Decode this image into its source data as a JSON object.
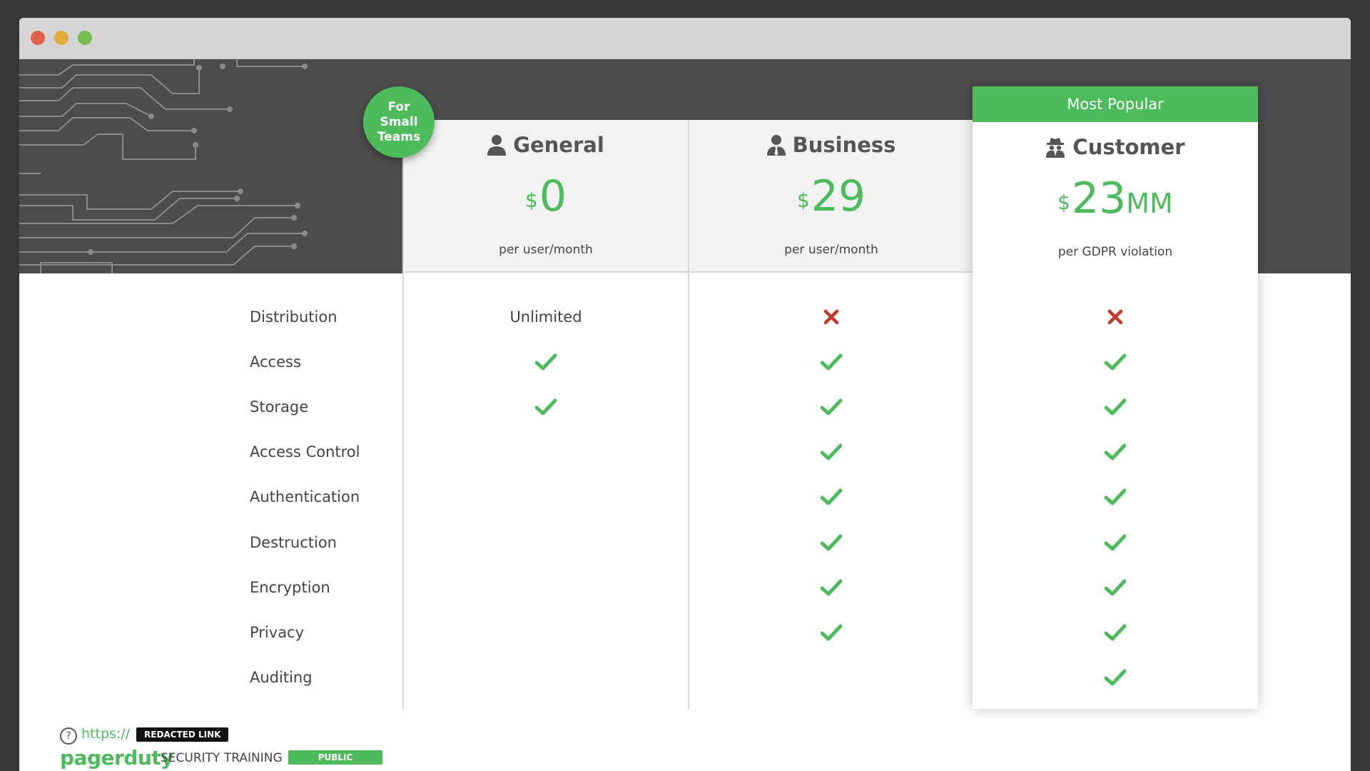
{
  "badge": {
    "line1": "For",
    "line2": "Small",
    "line3": "Teams"
  },
  "plans": [
    {
      "name": "General",
      "icon": "user-icon",
      "currency": "$",
      "amount": "0",
      "suffix": "",
      "per": "per user/month"
    },
    {
      "name": "Business",
      "icon": "businessman-icon",
      "currency": "$",
      "amount": "29",
      "suffix": "",
      "per": "per user/month"
    },
    {
      "name": "Customer",
      "icon": "spy-icon",
      "currency": "$",
      "amount": "23",
      "suffix": "MM",
      "per": "per GDPR violation",
      "highlight": "Most Popular"
    }
  ],
  "features": [
    "Distribution",
    "Access",
    "Storage",
    "Access Control",
    "Authentication",
    "Destruction",
    "Encryption",
    "Privacy",
    "Auditing"
  ],
  "matrix": {
    "general": [
      "Unlimited",
      "check",
      "check",
      "",
      "",
      "",
      "",
      "",
      ""
    ],
    "business": [
      "cross",
      "check",
      "check",
      "check",
      "check",
      "check",
      "check",
      "check",
      ""
    ],
    "customer": [
      "cross",
      "check",
      "check",
      "check",
      "check",
      "check",
      "check",
      "check",
      "check"
    ]
  },
  "footer": {
    "url_prefix": "https://",
    "redacted": "REDACTED LINK",
    "logo": "pagerduty",
    "training": "SECURITY TRAINING",
    "classification": "PUBLIC"
  },
  "colors": {
    "accent": "#4dbb5c",
    "cross": "#c0392b",
    "hero": "#4c4c4c"
  }
}
